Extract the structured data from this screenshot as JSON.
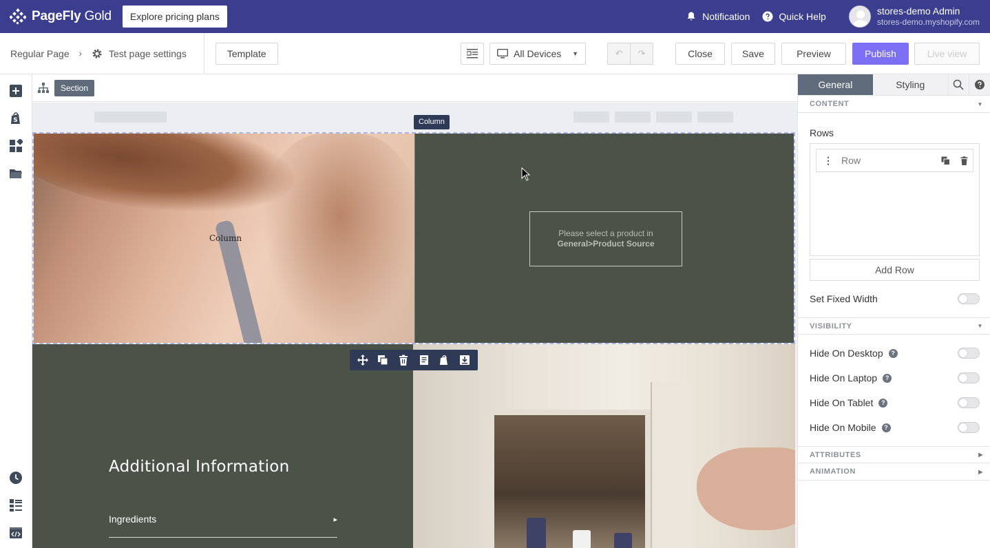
{
  "topbar": {
    "brand": "PageFly",
    "brand_suffix": "Gold",
    "pricing_button": "Explore pricing plans",
    "notification": "Notification",
    "quick_help": "Quick Help",
    "user_name": "stores-demo Admin",
    "user_store": "stores-demo.myshopify.com"
  },
  "toolbar": {
    "breadcrumb_page": "Regular Page",
    "breadcrumb_sep": "›",
    "page_settings": "Test page settings",
    "template": "Template",
    "devices": "All Devices",
    "close": "Close",
    "save": "Save",
    "preview": "Preview",
    "publish": "Publish",
    "live_view": "Live view"
  },
  "canvas": {
    "section_tag": "Section",
    "column_tag": "Column",
    "image_label": "Column",
    "product_notice_line1": "Please select a product in",
    "product_notice_line2": "General>Product Source",
    "info_title": "Additional Information",
    "ingredients": "Ingredients",
    "ingredients_arrow": "▸"
  },
  "panel": {
    "tabs": {
      "general": "General",
      "styling": "Styling"
    },
    "content_header": "CONTENT",
    "rows_label": "Rows",
    "row_item": "Row",
    "add_row": "Add Row",
    "fixed_width": "Set Fixed Width",
    "visibility_header": "VISIBILITY",
    "hide_desktop": "Hide On Desktop",
    "hide_laptop": "Hide On Laptop",
    "hide_tablet": "Hide On Tablet",
    "hide_mobile": "Hide On Mobile",
    "attributes_header": "ATTRIBUTES",
    "animation_header": "ANIMATION",
    "help_glyph": "?"
  },
  "colors": {
    "topbar_bg": "#3b3d8e",
    "publish_bg": "#7c6ff5",
    "panel_dark": "#4b5348",
    "active_tab": "#5f6b7a"
  }
}
